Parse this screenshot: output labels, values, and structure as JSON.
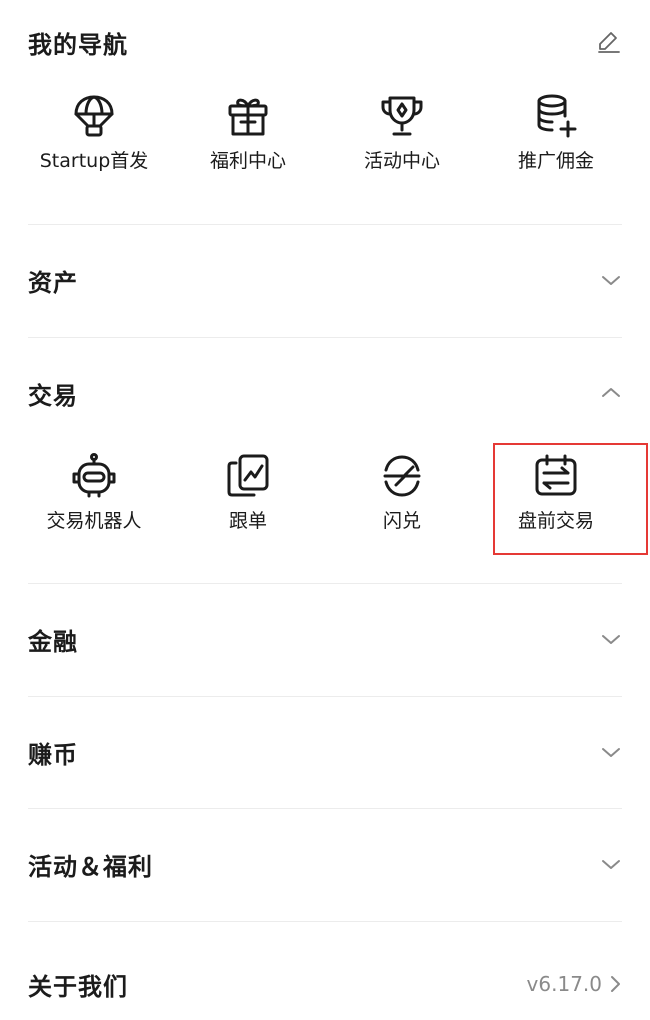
{
  "nav": {
    "title": "我的导航",
    "items": [
      {
        "label": "Startup首发",
        "icon": "parachute-icon"
      },
      {
        "label": "福利中心",
        "icon": "gift-icon"
      },
      {
        "label": "活动中心",
        "icon": "trophy-icon"
      },
      {
        "label": "推广佣金",
        "icon": "coins-plus-icon"
      }
    ]
  },
  "sections": {
    "assets": {
      "title": "资产",
      "state": "collapsed"
    },
    "trade": {
      "title": "交易",
      "state": "expanded",
      "items": [
        {
          "label": "交易机器人",
          "icon": "robot-icon"
        },
        {
          "label": "跟单",
          "icon": "copy-trade-icon"
        },
        {
          "label": "闪兑",
          "icon": "swap-icon"
        },
        {
          "label": "盘前交易",
          "icon": "pre-market-icon"
        }
      ]
    },
    "finance": {
      "title": "金融",
      "state": "collapsed"
    },
    "earn": {
      "title": "赚币",
      "state": "collapsed"
    },
    "events": {
      "title": "活动＆福利",
      "state": "collapsed"
    }
  },
  "about": {
    "title": "关于我们",
    "version": "v6.17.0"
  },
  "colors": {
    "highlight": "#e53935",
    "text": "#1b1b1b",
    "muted": "#8a8a8a",
    "divider": "#ececec"
  }
}
